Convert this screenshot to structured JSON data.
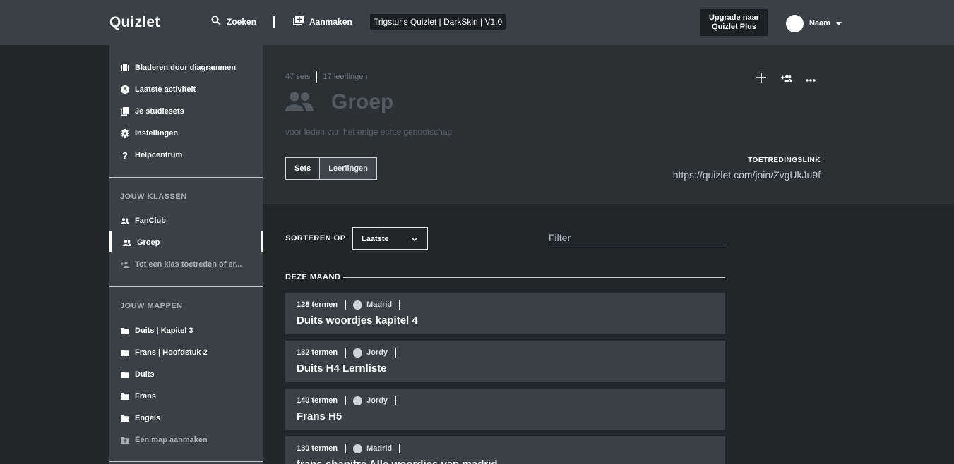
{
  "header": {
    "logo": "Quizlet",
    "search_label": "Zoeken",
    "create_label": "Aanmaken",
    "skin_badge": "Trigstur's Quizlet | DarkSkin | V1.0",
    "upgrade_line1": "Upgrade naar",
    "upgrade_line2": "Quizlet Plus",
    "user_name": "Naam"
  },
  "sidebar": {
    "main_items": [
      {
        "label": "Bladeren door diagrammen",
        "icon": "diagram-icon"
      },
      {
        "label": "Laatste activiteit",
        "icon": "clock-icon"
      },
      {
        "label": "Je studiesets",
        "icon": "sets-icon"
      },
      {
        "label": "Instellingen",
        "icon": "gear-icon"
      },
      {
        "label": "Helpcentrum",
        "icon": "help-icon"
      }
    ],
    "classes_heading": "JOUW KLASSEN",
    "classes": [
      {
        "label": "FanClub",
        "icon": "group-icon"
      },
      {
        "label": "Groep",
        "icon": "group-icon"
      },
      {
        "label": "Tot een klas toetreden of er...",
        "icon": "add-group-icon"
      }
    ],
    "folders_heading": "JOUW MAPPEN",
    "folders": [
      {
        "label": "Duits | Kapitel 3",
        "icon": "folder-icon"
      },
      {
        "label": "Frans | Hoofdstuk 2",
        "icon": "folder-icon"
      },
      {
        "label": "Duits",
        "icon": "folder-icon"
      },
      {
        "label": "Frans",
        "icon": "folder-icon"
      },
      {
        "label": "Engels",
        "icon": "folder-icon"
      },
      {
        "label": "Een map aanmaken",
        "icon": "add-folder-icon"
      }
    ]
  },
  "group": {
    "sets_count": "47 sets",
    "students_count": "17 leerlingen",
    "title": "Groep",
    "description": "voor leden van het enige echte genootschap",
    "tabs": [
      "Sets",
      "Leerlingen"
    ],
    "active_tab": "Leerlingen",
    "join_label": "TOETREDINGSLINK",
    "join_link": "https://quizlet.com/join/ZvgUkJu9f"
  },
  "content": {
    "sort_label": "SORTEREN OP",
    "sort_value": "Laatste",
    "filter_placeholder": "Filter",
    "month_label": "DEZE MAAND",
    "sets": [
      {
        "terms": "128 termen",
        "author": "Madrid",
        "title": "Duits woordjes kapitel 4"
      },
      {
        "terms": "132 termen",
        "author": "Jordy",
        "title": "Duits H4 Lernliste"
      },
      {
        "terms": "140 termen",
        "author": "Jordy",
        "title": "Frans H5"
      },
      {
        "terms": "139 termen",
        "author": "Madrid",
        "title": "frans chapitre Alle woordjes van madrid"
      }
    ]
  },
  "colors": {
    "topbar": "#3a4043",
    "background": "#222629",
    "panel": "#2c3033",
    "card": "#3a4043"
  }
}
